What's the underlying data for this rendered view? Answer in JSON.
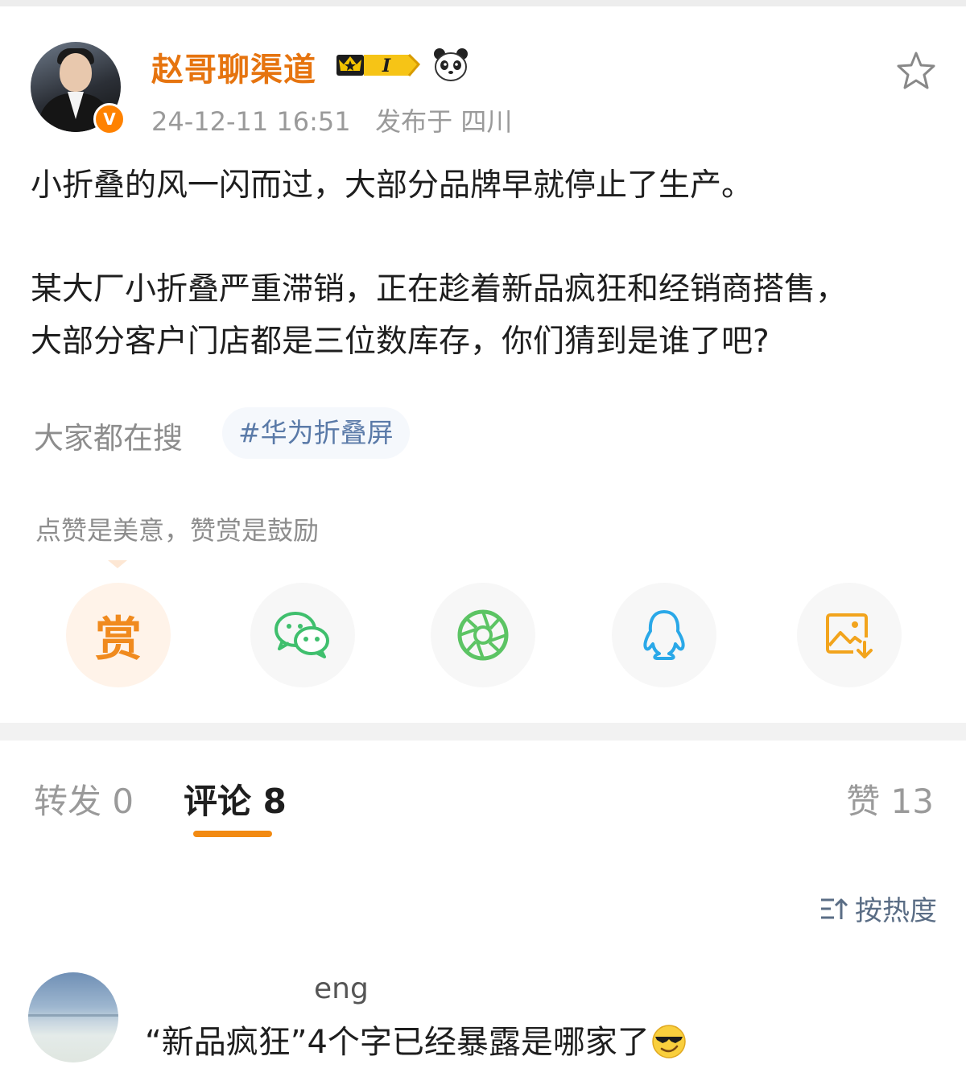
{
  "post": {
    "username": "赵哥聊渠道",
    "level_badge": "I",
    "verified_badge": "V",
    "timestamp": "24-12-11 16:51",
    "location": "发布于 四川",
    "paragraphs": [
      "小折叠的风一闪而过，大部分品牌早就停止了生产。",
      "某大厂小折叠严重滞销，正在趁着新品疯狂和经销商搭售，",
      "大部分客户门店都是三位数库存，你们猜到是谁了吧?"
    ],
    "search_label": "大家都在搜",
    "hot_topic": "#华为折叠屏",
    "reward_hint": "点赞是美意，赞赏是鼓励"
  },
  "share_buttons": [
    {
      "name": "reward",
      "label": "赏",
      "icon": "reward-icon",
      "color": "#f08a1e"
    },
    {
      "name": "wechat",
      "icon": "wechat-icon",
      "color": "#3fbf6d"
    },
    {
      "name": "moments",
      "icon": "moments-icon",
      "color": "#5cc464"
    },
    {
      "name": "qq",
      "icon": "qq-icon",
      "color": "#2aa8e8"
    },
    {
      "name": "save-image",
      "icon": "save-image-icon",
      "color": "#f2a41d"
    }
  ],
  "tabs": {
    "repost": "转发 0",
    "comments": "评论 8",
    "likes": "赞 13"
  },
  "sort": {
    "label": "按热度",
    "icon": "sort-icon"
  },
  "comments": [
    {
      "name_visible": "eng",
      "text": "“新品疯狂”4个字已经暴露是哪家了",
      "emoji": "sunglasses-emoji"
    }
  ],
  "colors": {
    "accent": "#f28a12",
    "username": "#e6740f",
    "topic": "#5a7aa8",
    "muted": "#9a9a9a"
  }
}
